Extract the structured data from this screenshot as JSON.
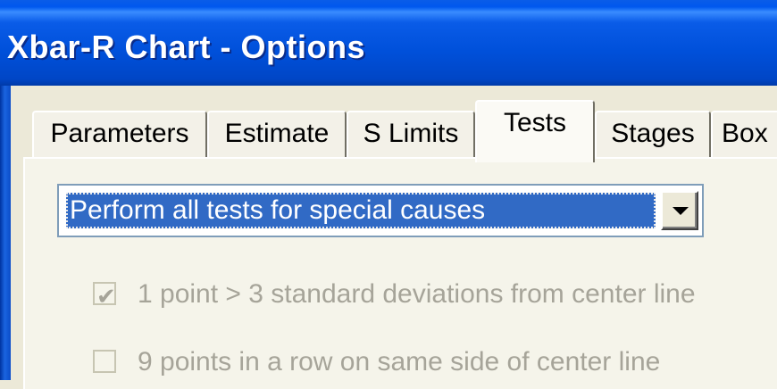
{
  "window": {
    "title": "Xbar-R Chart - Options"
  },
  "tabs": [
    {
      "label": "Parameters",
      "active": false
    },
    {
      "label": "Estimate",
      "active": false
    },
    {
      "label": "S Limits",
      "active": false
    },
    {
      "label": "Tests",
      "active": true
    },
    {
      "label": "Stages",
      "active": false
    },
    {
      "label": "Box",
      "active": false
    }
  ],
  "tests_dropdown": {
    "selected": "Perform all tests for special causes"
  },
  "tests": [
    {
      "label": "1 point > 3 standard deviations from center line",
      "checked": true,
      "enabled": false
    },
    {
      "label": "9 points in a row on same side of center line",
      "checked": false,
      "enabled": false
    }
  ],
  "colors": {
    "titlebar": "#0A5CE8",
    "selection": "#316AC5",
    "disabled_text": "#A6A499",
    "dialog_bg": "#ECE9D8"
  }
}
